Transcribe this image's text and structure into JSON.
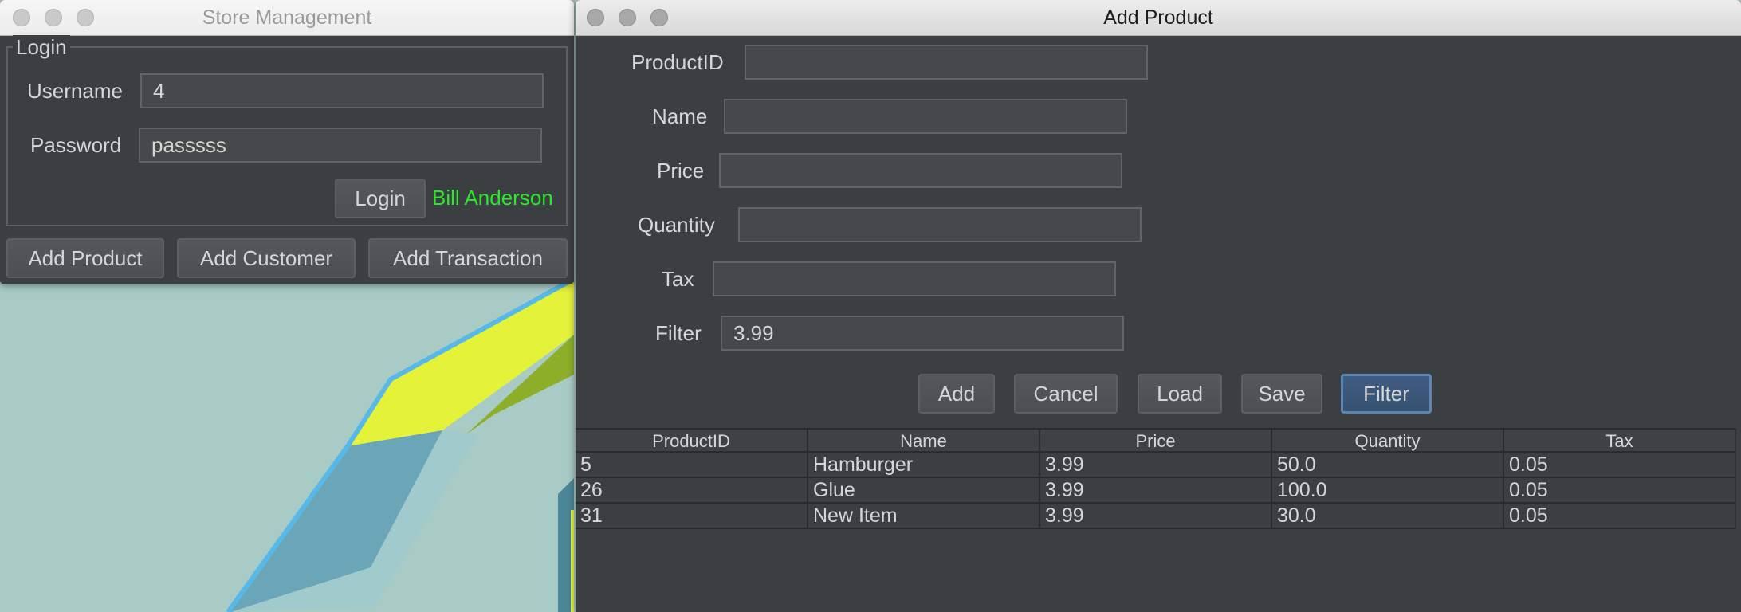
{
  "store_window": {
    "title": "Store Management",
    "login_group": {
      "legend": "Login",
      "username_label": "Username",
      "username_value": "4",
      "password_label": "Password",
      "password_value": "passsss",
      "login_button": "Login",
      "logged_in_user": "Bill Anderson"
    },
    "buttons": {
      "add_product": "Add Product",
      "add_customer": "Add Customer",
      "add_transaction": "Add Transaction"
    }
  },
  "product_window": {
    "title": "Add Product",
    "form": {
      "product_id_label": "ProductID",
      "product_id_value": "",
      "name_label": "Name",
      "name_value": "",
      "price_label": "Price",
      "price_value": "",
      "quantity_label": "Quantity",
      "quantity_value": "",
      "tax_label": "Tax",
      "tax_value": "",
      "filter_label": "Filter",
      "filter_value": "3.99"
    },
    "buttons": {
      "add": "Add",
      "cancel": "Cancel",
      "load": "Load",
      "save": "Save",
      "filter": "Filter"
    },
    "table": {
      "columns": [
        "ProductID",
        "Name",
        "Price",
        "Quantity",
        "Tax"
      ],
      "rows": [
        [
          "5",
          "Hamburger",
          "3.99",
          "50.0",
          "0.05"
        ],
        [
          "26",
          "Glue",
          "3.99",
          "100.0",
          "0.05"
        ],
        [
          "31",
          "New Item",
          "3.99",
          "30.0",
          "0.05"
        ]
      ]
    }
  },
  "colors": {
    "window_bg": "#3c3f41",
    "status_green": "#2be82b",
    "focus_blue": "#3f5c82",
    "wallpaper": "#a9cbc5"
  }
}
